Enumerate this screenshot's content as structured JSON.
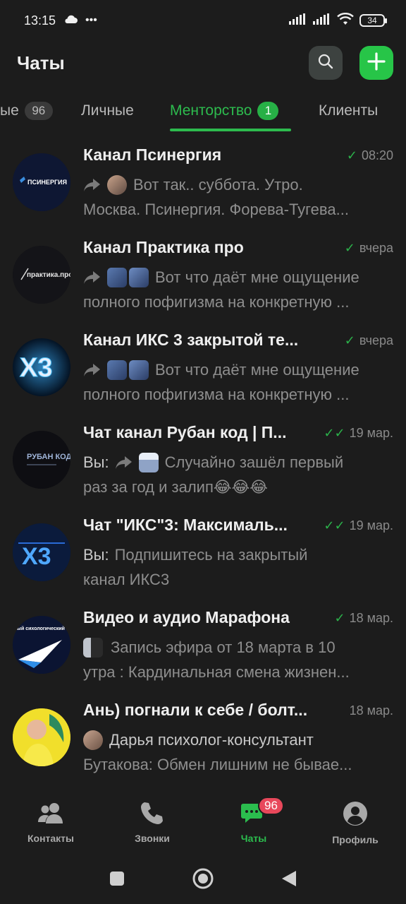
{
  "status_bar": {
    "time": "13:15",
    "extra": "•••",
    "battery": "34"
  },
  "header": {
    "title": "Чаты"
  },
  "tabs": [
    {
      "label": "ые",
      "count": "96"
    },
    {
      "label": "Личные"
    },
    {
      "label": "Менторство",
      "count": "1"
    },
    {
      "label": "Клиенты"
    }
  ],
  "chats": [
    {
      "name": "Канал Псинергия",
      "time": "08:20",
      "tick": "✓",
      "preview_line1": "Вот так.. суббота. Утро.",
      "preview_line2": "Москва. Псинергия. Форева-Тугева...",
      "avatar_text": "ПСИНЕРГИЯ"
    },
    {
      "name": "Канал Практика про",
      "time": "вчера",
      "tick": "✓",
      "preview_line1": "Вот что даёт мне ощущение",
      "preview_line2": "полного пофигизма на конкретную ...",
      "avatar_text": "практика.про"
    },
    {
      "name": "Канал ИКС 3 закрытой те...",
      "time": "вчера",
      "tick": "✓",
      "preview_line1": "Вот что даёт мне ощущение",
      "preview_line2": "полного пофигизма на конкретную ...",
      "avatar_text": "X3"
    },
    {
      "name": "Чат канал Рубан код | П...",
      "time": "19 мар.",
      "tick": "✓✓",
      "you": "Вы:",
      "preview_line1": "Случайно зашёл первый",
      "preview_line2": "раз за год и залип😂😂😂",
      "avatar_text": "РУБАН КОД"
    },
    {
      "name": "Чат \"ИКС\"3: Максималь...",
      "time": "19 мар.",
      "tick": "✓✓",
      "you": "Вы:",
      "preview_line1": "Подпишитесь на закрытый",
      "preview_line2": "канал ИКС3",
      "avatar_text": "X3"
    },
    {
      "name": "Видео и аудио Марафона",
      "time": "18 мар.",
      "tick": "✓",
      "preview_line1": "Запись эфира от 18 марта в 10",
      "preview_line2": "утра : Кардинальная смена жизнен...",
      "avatar_text": "ый сихологический Телеграмм-Марафон"
    },
    {
      "name": "Ань) погнали к себе / болт...",
      "time": "18 мар.",
      "preview_line1": "Дарья психолог-консультант",
      "preview_line2": "Бутакова: Обмен лишним не бывае..."
    }
  ],
  "bottom_nav": [
    {
      "label": "Контакты",
      "icon": "contacts-icon"
    },
    {
      "label": "Звонки",
      "icon": "phone-icon"
    },
    {
      "label": "Чаты",
      "icon": "chats-icon",
      "badge": "96"
    },
    {
      "label": "Профиль",
      "icon": "profile-icon"
    }
  ],
  "colors": {
    "accent": "#2dbb4e",
    "badge": "#e8485b",
    "background": "#1c1c1c"
  }
}
